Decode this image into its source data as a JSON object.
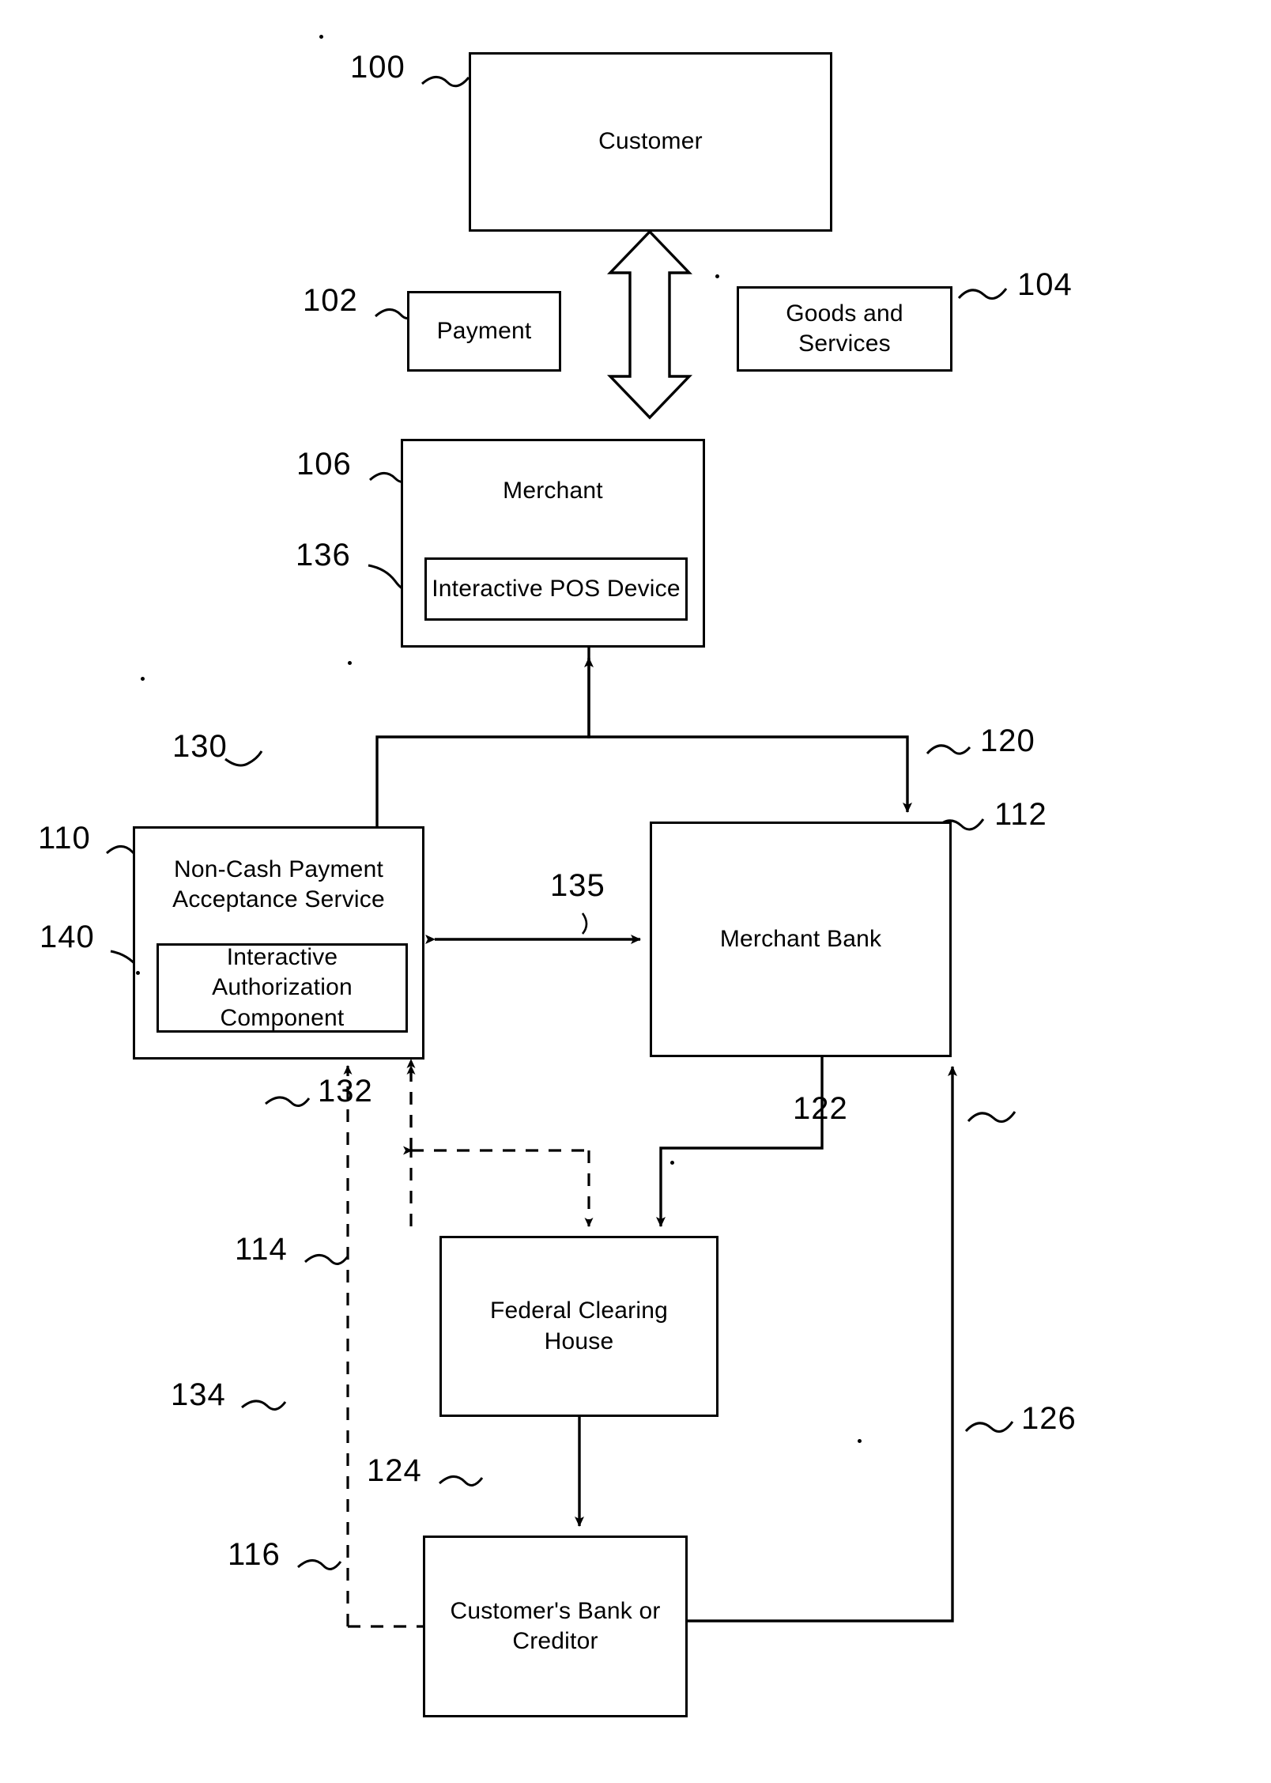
{
  "figure": {
    "type": "patent-block-diagram",
    "title": "Non-Cash Payment Acceptance System",
    "background_color": "#ffffff",
    "line_color": "#000000"
  },
  "nodes": [
    {
      "id": "n100",
      "ref": "100",
      "label": "Customer",
      "lines": [
        "Customer"
      ]
    },
    {
      "id": "n102",
      "ref": "102",
      "label": "Payment",
      "lines": [
        "Payment"
      ]
    },
    {
      "id": "n104",
      "ref": "104",
      "label": "Goods and Services",
      "lines": [
        "Goods and",
        "Services"
      ]
    },
    {
      "id": "n106",
      "ref": "106",
      "label": "Merchant",
      "lines": [
        "Merchant"
      ]
    },
    {
      "id": "n136",
      "ref": "136",
      "label": "Interactive POS Device",
      "lines": [
        "Interactive POS Device"
      ]
    },
    {
      "id": "n110",
      "ref": "110",
      "label": "Non-Cash Payment Acceptance Service",
      "lines": [
        "Non-Cash Payment",
        "Acceptance Service"
      ]
    },
    {
      "id": "n140",
      "ref": "140",
      "label": "Interactive Authorization Component",
      "lines": [
        "Interactive Authorization",
        "Component"
      ]
    },
    {
      "id": "n112",
      "ref": "112",
      "label": "Merchant Bank",
      "lines": [
        "Merchant Bank"
      ]
    },
    {
      "id": "n114",
      "ref": "114",
      "label": "Federal Clearing House",
      "lines": [
        "Federal Clearing",
        "House"
      ]
    },
    {
      "id": "n116",
      "ref": "116",
      "label": "Customer's Bank or Creditor",
      "lines": [
        "Customer's Bank or",
        "Creditor"
      ]
    }
  ],
  "connector_refs": [
    {
      "id": "c120",
      "ref": "120",
      "from": "Merchant",
      "to": "Merchant Bank",
      "style": "solid",
      "arrow": "single"
    },
    {
      "id": "c130",
      "ref": "130",
      "from": "Non-Cash Payment Acceptance Service",
      "to": "Merchant",
      "style": "solid",
      "arrow": "single"
    },
    {
      "id": "c135",
      "ref": "135",
      "from": "Non-Cash Payment Acceptance Service",
      "to": "Merchant Bank",
      "style": "solid",
      "arrow": "double"
    },
    {
      "id": "c122",
      "ref": "122",
      "from": "Merchant Bank",
      "to": "Federal Clearing House",
      "style": "solid",
      "arrow": "single"
    },
    {
      "id": "c132",
      "ref": "132",
      "from": "Non-Cash Payment Acceptance Service",
      "to": "Federal Clearing House",
      "style": "dashed",
      "arrow": "double"
    },
    {
      "id": "c134",
      "ref": "134",
      "from": "Non-Cash Payment Acceptance Service",
      "to": "Customer's Bank or Creditor",
      "style": "dashed",
      "arrow": "double"
    },
    {
      "id": "c124",
      "ref": "124",
      "from": "Federal Clearing House",
      "to": "Customer's Bank or Creditor",
      "style": "solid",
      "arrow": "single"
    },
    {
      "id": "c126",
      "ref": "126",
      "from": "Customer's Bank or Creditor",
      "to": "Merchant Bank",
      "style": "solid",
      "arrow": "single"
    }
  ],
  "ref_numbers": {
    "r100": "100",
    "r102": "102",
    "r104": "104",
    "r106": "106",
    "r110": "110",
    "r112": "112",
    "r114": "114",
    "r116": "116",
    "r120": "120",
    "r122": "122",
    "r124": "124",
    "r126": "126",
    "r130": "130",
    "r132": "132",
    "r134": "134",
    "r135": "135",
    "r136": "136",
    "r140": "140"
  },
  "node_text": {
    "customer": "Customer",
    "payment": "Payment",
    "goods_l1": "Goods and",
    "goods_l2": "Services",
    "merchant": "Merchant",
    "pos_device": "Interactive POS Device",
    "ncpas_l1": "Non-Cash Payment",
    "ncpas_l2": "Acceptance Service",
    "iac_l1": "Interactive Authorization",
    "iac_l2": "Component",
    "merchant_bank": "Merchant Bank",
    "fch_l1": "Federal Clearing",
    "fch_l2": "House",
    "cbank_l1": "Customer's Bank or",
    "cbank_l2": "Creditor"
  }
}
